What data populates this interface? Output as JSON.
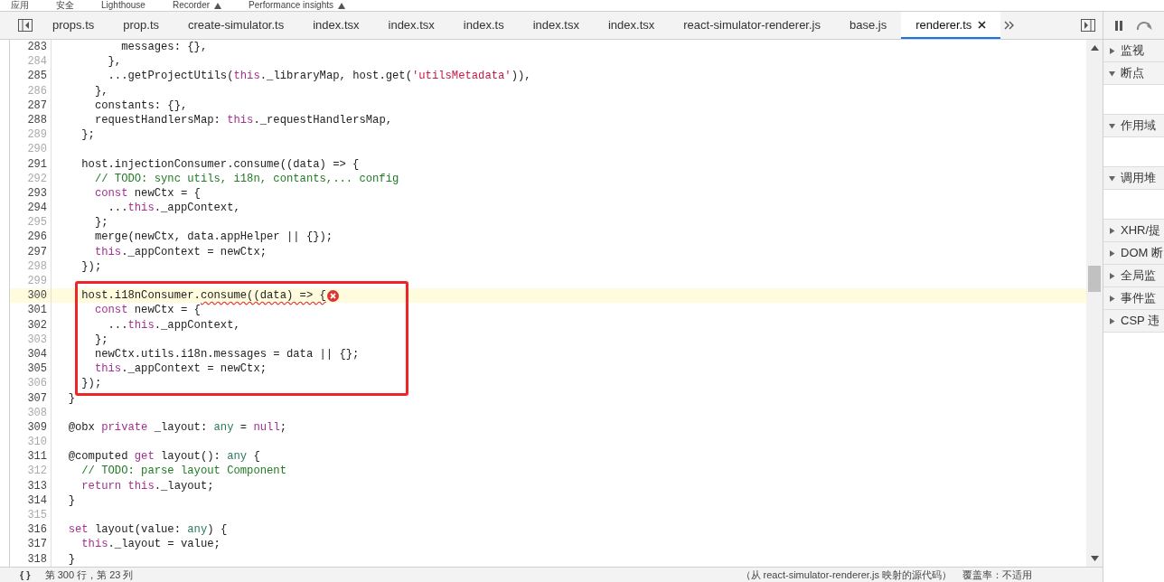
{
  "panel_tabs": [
    {
      "label": "应用",
      "marked": false
    },
    {
      "label": "安全",
      "marked": false
    },
    {
      "label": "Lighthouse",
      "marked": false
    },
    {
      "label": "Recorder",
      "marked": true
    },
    {
      "label": "Performance insights",
      "marked": true
    }
  ],
  "tabs": [
    {
      "label": "props.ts",
      "selected": false
    },
    {
      "label": "prop.ts",
      "selected": false
    },
    {
      "label": "create-simulator.ts",
      "selected": false
    },
    {
      "label": "index.tsx",
      "selected": false
    },
    {
      "label": "index.tsx",
      "selected": false
    },
    {
      "label": "index.ts",
      "selected": false
    },
    {
      "label": "index.tsx",
      "selected": false
    },
    {
      "label": "index.tsx",
      "selected": false
    },
    {
      "label": "react-simulator-renderer.js",
      "selected": false
    },
    {
      "label": "base.js",
      "selected": false
    },
    {
      "label": "renderer.ts",
      "selected": true
    }
  ],
  "code": [
    {
      "kind": "plain",
      "lines": [
        {
          "number": "283",
          "breakable": true,
          "current": false,
          "kind": "normal",
          "tokens": [
            {
              "text": "          messages: {},",
              "kind": "plain"
            }
          ]
        },
        {
          "number": "284",
          "breakable": false,
          "current": false,
          "kind": "normal",
          "tokens": [
            {
              "text": "        },",
              "kind": "plain"
            }
          ]
        },
        {
          "number": "285",
          "breakable": true,
          "current": false,
          "kind": "normal",
          "tokens": [
            {
              "text": "        ...getProjectUtils(",
              "kind": "plain"
            },
            {
              "text": "this",
              "kind": "keyword"
            },
            {
              "text": "._libraryMap, host.get(",
              "kind": "plain"
            },
            {
              "text": "'utilsMetadata'",
              "kind": "string"
            },
            {
              "text": ")),",
              "kind": "plain"
            }
          ]
        },
        {
          "number": "286",
          "breakable": false,
          "current": false,
          "kind": "normal",
          "tokens": [
            {
              "text": "      },",
              "kind": "plain"
            }
          ]
        },
        {
          "number": "287",
          "breakable": true,
          "current": false,
          "kind": "normal",
          "tokens": [
            {
              "text": "      constants: {},",
              "kind": "plain"
            }
          ]
        },
        {
          "number": "288",
          "breakable": true,
          "current": false,
          "kind": "normal",
          "tokens": [
            {
              "text": "      requestHandlersMap: ",
              "kind": "plain"
            },
            {
              "text": "this",
              "kind": "keyword"
            },
            {
              "text": "._requestHandlersMap,",
              "kind": "plain"
            }
          ]
        },
        {
          "number": "289",
          "breakable": false,
          "current": false,
          "kind": "normal",
          "tokens": [
            {
              "text": "    };",
              "kind": "plain"
            }
          ]
        },
        {
          "number": "290",
          "breakable": false,
          "current": false,
          "kind": "normal"
        },
        {
          "number": "291",
          "breakable": true,
          "current": false,
          "kind": "normal",
          "tokens": [
            {
              "text": "    host.injectionConsumer.consume((data) => {",
              "kind": "plain"
            }
          ]
        },
        {
          "number": "292",
          "breakable": false,
          "current": false,
          "kind": "normal",
          "tokens": [
            {
              "text": "      // TODO: sync utils, i18n, contants,... config",
              "kind": "comment"
            }
          ]
        },
        {
          "number": "293",
          "breakable": true,
          "current": false,
          "kind": "normal",
          "tokens": [
            {
              "text": "      const",
              "kind": "keyword"
            },
            {
              "text": " newCtx = {",
              "kind": "plain"
            }
          ]
        },
        {
          "number": "294",
          "breakable": true,
          "current": false,
          "kind": "normal",
          "tokens": [
            {
              "text": "        ...",
              "kind": "plain"
            },
            {
              "text": "this",
              "kind": "keyword"
            },
            {
              "text": "._appContext,",
              "kind": "plain"
            }
          ]
        },
        {
          "number": "295",
          "breakable": false,
          "current": false,
          "kind": "normal",
          "tokens": [
            {
              "text": "      };",
              "kind": "plain"
            }
          ]
        },
        {
          "number": "296",
          "breakable": true,
          "current": false,
          "kind": "normal",
          "tokens": [
            {
              "text": "      merge(newCtx, data.appHelper || {});",
              "kind": "plain"
            }
          ]
        },
        {
          "number": "297",
          "breakable": true,
          "current": false,
          "kind": "normal",
          "tokens": [
            {
              "text": "      this",
              "kind": "keyword"
            },
            {
              "text": "._appContext = newCtx;",
              "kind": "plain"
            }
          ]
        },
        {
          "number": "298",
          "breakable": false,
          "current": false,
          "kind": "normal",
          "tokens": [
            {
              "text": "    });",
              "kind": "plain"
            }
          ]
        },
        {
          "number": "299",
          "breakable": false,
          "current": false,
          "kind": "normal"
        }
      ]
    },
    {
      "kind": "boxed",
      "lines": [
        {
          "number": "300",
          "breakable": true,
          "current": true,
          "kind": "error",
          "tokens": [
            {
              "text": "    host.i18nConsumer.",
              "kind": "plain"
            },
            {
              "text": "consume((data) => {",
              "kind": "squiggle"
            }
          ]
        },
        {
          "number": "301",
          "breakable": true,
          "current": false,
          "kind": "normal",
          "tokens": [
            {
              "text": "      const",
              "kind": "keyword"
            },
            {
              "text": " newCtx = {",
              "kind": "plain"
            }
          ]
        },
        {
          "number": "302",
          "breakable": true,
          "current": false,
          "kind": "normal",
          "tokens": [
            {
              "text": "        ...",
              "kind": "plain"
            },
            {
              "text": "this",
              "kind": "keyword"
            },
            {
              "text": "._appContext,",
              "kind": "plain"
            }
          ]
        },
        {
          "number": "303",
          "breakable": false,
          "current": false,
          "kind": "normal",
          "tokens": [
            {
              "text": "      };",
              "kind": "plain"
            }
          ]
        },
        {
          "number": "304",
          "breakable": true,
          "current": false,
          "kind": "normal",
          "tokens": [
            {
              "text": "      newCtx.utils.i18n.messages = data || {};",
              "kind": "plain"
            }
          ]
        },
        {
          "number": "305",
          "breakable": true,
          "current": false,
          "kind": "normal",
          "tokens": [
            {
              "text": "      this",
              "kind": "keyword"
            },
            {
              "text": "._appContext = newCtx;",
              "kind": "plain"
            }
          ]
        },
        {
          "number": "306",
          "breakable": false,
          "current": false,
          "kind": "normal",
          "tokens": [
            {
              "text": "    });",
              "kind": "plain"
            }
          ]
        }
      ]
    },
    {
      "kind": "plain",
      "lines": [
        {
          "number": "307",
          "breakable": true,
          "current": false,
          "kind": "normal",
          "tokens": [
            {
              "text": "  }",
              "kind": "plain"
            }
          ]
        },
        {
          "number": "308",
          "breakable": false,
          "current": false,
          "kind": "normal"
        },
        {
          "number": "309",
          "breakable": true,
          "current": false,
          "kind": "normal",
          "tokens": [
            {
              "text": "  @obx ",
              "kind": "plain"
            },
            {
              "text": "private",
              "kind": "keyword"
            },
            {
              "text": " _layout: ",
              "kind": "plain"
            },
            {
              "text": "any",
              "kind": "type"
            },
            {
              "text": " = ",
              "kind": "plain"
            },
            {
              "text": "null",
              "kind": "keyword"
            },
            {
              "text": ";",
              "kind": "plain"
            }
          ]
        },
        {
          "number": "310",
          "breakable": false,
          "current": false,
          "kind": "normal"
        },
        {
          "number": "311",
          "breakable": true,
          "current": false,
          "kind": "normal",
          "tokens": [
            {
              "text": "  @computed ",
              "kind": "plain"
            },
            {
              "text": "get",
              "kind": "keyword"
            },
            {
              "text": " layout(): ",
              "kind": "plain"
            },
            {
              "text": "any",
              "kind": "type"
            },
            {
              "text": " {",
              "kind": "plain"
            }
          ]
        },
        {
          "number": "312",
          "breakable": false,
          "current": false,
          "kind": "normal",
          "tokens": [
            {
              "text": "    // TODO: parse layout Component",
              "kind": "comment"
            }
          ]
        },
        {
          "number": "313",
          "breakable": true,
          "current": false,
          "kind": "normal",
          "tokens": [
            {
              "text": "    return this",
              "kind": "keyword"
            },
            {
              "text": "._layout;",
              "kind": "plain"
            }
          ]
        },
        {
          "number": "314",
          "breakable": true,
          "current": false,
          "kind": "normal",
          "tokens": [
            {
              "text": "  }",
              "kind": "plain"
            }
          ]
        },
        {
          "number": "315",
          "breakable": false,
          "current": false,
          "kind": "normal"
        },
        {
          "number": "316",
          "breakable": true,
          "current": false,
          "kind": "normal",
          "tokens": [
            {
              "text": "  set",
              "kind": "keyword"
            },
            {
              "text": " layout(value: ",
              "kind": "plain"
            },
            {
              "text": "any",
              "kind": "type"
            },
            {
              "text": ") {",
              "kind": "plain"
            }
          ]
        },
        {
          "number": "317",
          "breakable": true,
          "current": false,
          "kind": "normal",
          "tokens": [
            {
              "text": "    this",
              "kind": "keyword"
            },
            {
              "text": "._layout = value;",
              "kind": "plain"
            }
          ]
        },
        {
          "number": "318",
          "breakable": true,
          "current": false,
          "kind": "normal",
          "tokens": [
            {
              "text": "  }",
              "kind": "plain"
            }
          ]
        }
      ]
    }
  ],
  "sidebar": {
    "sections": [
      {
        "label": "监视",
        "expanded": false
      },
      {
        "label": "断点",
        "expanded": true
      },
      {
        "label": "作用域",
        "expanded": true
      },
      {
        "label": "调用堆",
        "expanded": true
      },
      {
        "label": "XHR/提",
        "expanded": false
      },
      {
        "label": "DOM 断",
        "expanded": false
      },
      {
        "label": "全局监",
        "expanded": false
      },
      {
        "label": "事件监",
        "expanded": false
      },
      {
        "label": "CSP 违",
        "expanded": false
      }
    ]
  },
  "status_bar": {
    "format_icon": "{ }",
    "position": "第 300 行，第 23 列",
    "source": "（从 react-simulator-renderer.js 映射的源代码）",
    "coverage": "覆盖率：不适用"
  }
}
